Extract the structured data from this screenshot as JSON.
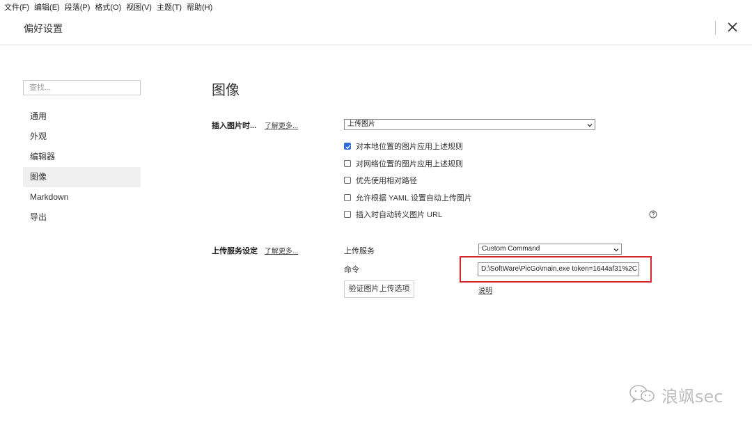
{
  "menubar": {
    "items": [
      "文件(F)",
      "编辑(E)",
      "段落(P)",
      "格式(O)",
      "视图(V)",
      "主题(T)",
      "帮助(H)"
    ]
  },
  "header": {
    "title": "偏好设置",
    "close_icon": "close-icon"
  },
  "sidebar": {
    "search_placeholder": "查找...",
    "items": [
      {
        "label": "通用",
        "active": false
      },
      {
        "label": "外观",
        "active": false
      },
      {
        "label": "编辑器",
        "active": false
      },
      {
        "label": "图像",
        "active": true
      },
      {
        "label": "Markdown",
        "active": false
      },
      {
        "label": "导出",
        "active": false
      }
    ]
  },
  "main": {
    "title": "图像",
    "insert_section": {
      "label": "插入图片时...",
      "learn_more": "了解更多...",
      "select_value": "上传图片",
      "options": [
        {
          "label": "对本地位置的图片应用上述规则",
          "checked": true
        },
        {
          "label": "对网络位置的图片应用上述规则",
          "checked": false
        },
        {
          "label": "优先使用相对路径",
          "checked": false
        },
        {
          "label": "允许根据 YAML 设置自动上传图片",
          "checked": false
        },
        {
          "label": "插入时自动转义图片 URL",
          "checked": false
        }
      ],
      "help_icon": "question-circle-icon"
    },
    "upload_section": {
      "label": "上传服务设定",
      "learn_more": "了解更多...",
      "service_label": "上传服务",
      "service_value": "Custom Command",
      "command_label": "命令",
      "command_value": "D:\\SoftWare\\PicGo\\main.exe token=1644af31%2C",
      "verify_button": "验证图片上传选项",
      "doc_link": "说明",
      "highlight_color": "#d9262c"
    }
  },
  "watermark": {
    "text": "浪飒sec",
    "icon": "wechat-icon"
  },
  "colors": {
    "accent": "#2b6fd6",
    "active_nav_bg": "#f0f0f0"
  }
}
